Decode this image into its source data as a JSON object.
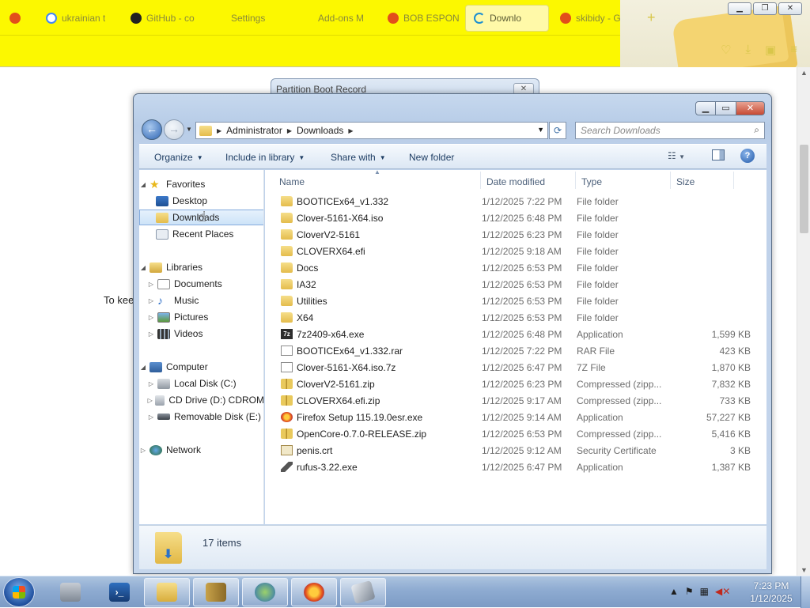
{
  "browser": {
    "tabs": [
      {
        "label": "",
        "icon": "firefox-icon",
        "color": "#e24e1b"
      },
      {
        "label": "ukrainian t",
        "icon": "google-icon",
        "color": "#4285f4"
      },
      {
        "label": "GitHub - co",
        "icon": "github-icon",
        "color": "#222222"
      },
      {
        "label": "Settings",
        "icon": "gear-icon",
        "color": ""
      },
      {
        "label": "Add-ons M",
        "icon": "puzzle-icon",
        "color": ""
      },
      {
        "label": "BOB ESPON",
        "icon": "firefox-icon",
        "color": "#e24e1b"
      },
      {
        "label": "Downlo",
        "icon": "loading-icon",
        "color": "#1b8ed1"
      },
      {
        "label": "skibidy - G",
        "icon": "firefox-icon",
        "color": "#e24e1b"
      }
    ],
    "new_tab_label": "+",
    "page_text": "To kee"
  },
  "pbr_dialog": {
    "title": "Partition Boot Record",
    "close_label": "✕"
  },
  "explorer": {
    "address": {
      "crumbs": [
        "Administrator",
        "Downloads"
      ]
    },
    "search_placeholder": "Search Downloads",
    "commands": {
      "organize": "Organize",
      "include_in_library": "Include in library",
      "share_with": "Share with",
      "new_folder": "New folder"
    },
    "nav": {
      "favorites": "Favorites",
      "desktop": "Desktop",
      "downloads": "Downloads",
      "recent_places": "Recent Places",
      "libraries": "Libraries",
      "documents": "Documents",
      "music": "Music",
      "pictures": "Pictures",
      "videos": "Videos",
      "computer": "Computer",
      "local_disk": "Local Disk (C:)",
      "cd_drive": "CD Drive (D:) CDROM",
      "removable_disk": "Removable Disk (E:)",
      "network": "Network"
    },
    "columns": {
      "name": "Name",
      "date": "Date modified",
      "type": "Type",
      "size": "Size"
    },
    "files": [
      {
        "name": "BOOTICEx64_v1.332",
        "date": "1/12/2025 7:22 PM",
        "type": "File folder",
        "size": "",
        "icon": "folder"
      },
      {
        "name": "Clover-5161-X64.iso",
        "date": "1/12/2025 6:48 PM",
        "type": "File folder",
        "size": "",
        "icon": "folder"
      },
      {
        "name": "CloverV2-5161",
        "date": "1/12/2025 6:23 PM",
        "type": "File folder",
        "size": "",
        "icon": "folder"
      },
      {
        "name": "CLOVERX64.efi",
        "date": "1/12/2025 9:18 AM",
        "type": "File folder",
        "size": "",
        "icon": "folder"
      },
      {
        "name": "Docs",
        "date": "1/12/2025 6:53 PM",
        "type": "File folder",
        "size": "",
        "icon": "folder"
      },
      {
        "name": "IA32",
        "date": "1/12/2025 6:53 PM",
        "type": "File folder",
        "size": "",
        "icon": "folder"
      },
      {
        "name": "Utilities",
        "date": "1/12/2025 6:53 PM",
        "type": "File folder",
        "size": "",
        "icon": "folder"
      },
      {
        "name": "X64",
        "date": "1/12/2025 6:53 PM",
        "type": "File folder",
        "size": "",
        "icon": "folder"
      },
      {
        "name": "7z2409-x64.exe",
        "date": "1/12/2025 6:48 PM",
        "type": "Application",
        "size": "1,599 KB",
        "icon": "app"
      },
      {
        "name": "BOOTICEx64_v1.332.rar",
        "date": "1/12/2025 7:22 PM",
        "type": "RAR File",
        "size": "423 KB",
        "icon": "doc"
      },
      {
        "name": "Clover-5161-X64.iso.7z",
        "date": "1/12/2025 6:47 PM",
        "type": "7Z File",
        "size": "1,870 KB",
        "icon": "doc"
      },
      {
        "name": "CloverV2-5161.zip",
        "date": "1/12/2025 6:23 PM",
        "type": "Compressed (zipp...",
        "size": "7,832 KB",
        "icon": "zip"
      },
      {
        "name": "CLOVERX64.efi.zip",
        "date": "1/12/2025 9:17 AM",
        "type": "Compressed (zipp...",
        "size": "733 KB",
        "icon": "zip"
      },
      {
        "name": "Firefox Setup 115.19.0esr.exe",
        "date": "1/12/2025 9:14 AM",
        "type": "Application",
        "size": "57,227 KB",
        "icon": "fox"
      },
      {
        "name": "OpenCore-0.7.0-RELEASE.zip",
        "date": "1/12/2025 6:53 PM",
        "type": "Compressed (zipp...",
        "size": "5,416 KB",
        "icon": "zip"
      },
      {
        "name": "penis.crt",
        "date": "1/12/2025 9:12 AM",
        "type": "Security Certificate",
        "size": "3 KB",
        "icon": "cert"
      },
      {
        "name": "rufus-3.22.exe",
        "date": "1/12/2025 6:47 PM",
        "type": "Application",
        "size": "1,387 KB",
        "icon": "usb"
      }
    ],
    "status": "17 items"
  },
  "taskbar": {
    "time": "7:23 PM",
    "date": "1/12/2025"
  }
}
